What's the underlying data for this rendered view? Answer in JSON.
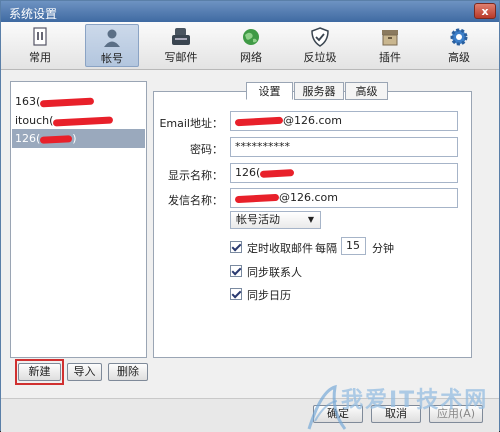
{
  "window": {
    "title": "系统设置",
    "close_label": "x"
  },
  "toolbar": {
    "items": [
      {
        "label": "常用",
        "icon": "general-icon"
      },
      {
        "label": "帐号",
        "icon": "account-icon",
        "active": true
      },
      {
        "label": "写邮件",
        "icon": "compose-icon"
      },
      {
        "label": "网络",
        "icon": "network-icon"
      },
      {
        "label": "反垃圾",
        "icon": "antispam-shield-icon"
      },
      {
        "label": "插件",
        "icon": "plugin-box-icon"
      },
      {
        "label": "高级",
        "icon": "advanced-gear-icon"
      }
    ]
  },
  "accounts": [
    {
      "prefix": "163(",
      "suffix": ""
    },
    {
      "prefix": "itouch(",
      "suffix": ""
    },
    {
      "prefix": "126(",
      "suffix": ")",
      "selected": true
    }
  ],
  "tabs": [
    "设置",
    "服务器",
    "高级"
  ],
  "form": {
    "email_label": "Email地址：",
    "email_value": "@126.com",
    "password_label": "密码：",
    "password_value": "**********",
    "display_label": "显示名称：",
    "display_value": "126(",
    "sender_label": "发信名称：",
    "sender_value": "@126.com",
    "status_select": "帐号活动",
    "auto_receive_label": "定时收取邮件",
    "interval_prefix": "每隔",
    "interval_value": "15",
    "interval_unit": "分钟",
    "sync_contacts_label": "同步联系人",
    "sync_calendar_label": "同步日历"
  },
  "buttons": {
    "new": "新建",
    "import": "导入",
    "delete": "删除",
    "ok": "确定",
    "cancel": "取消",
    "apply": "应用(A)"
  },
  "watermark": "我爱IT技术网",
  "colors": {
    "selection": "#9aa9bd",
    "redaction": "#e8202a",
    "highlight": "#d03030"
  }
}
